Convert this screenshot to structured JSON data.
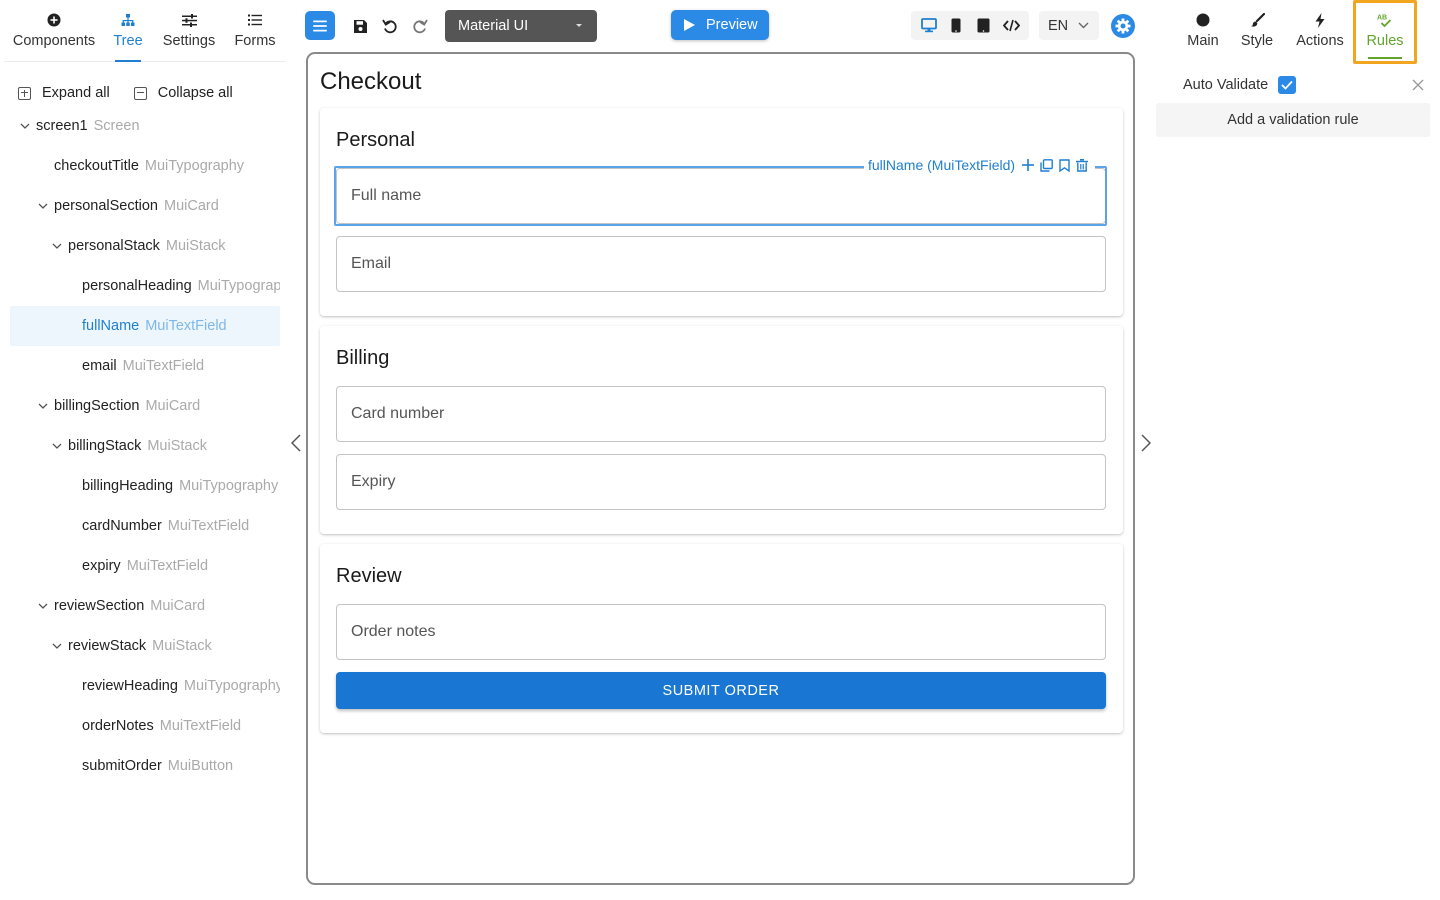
{
  "left_tabs": [
    {
      "label": "Components",
      "icon": "add-circle-icon"
    },
    {
      "label": "Tree",
      "icon": "sitemap-icon",
      "active": true
    },
    {
      "label": "Settings",
      "icon": "sliders-icon"
    },
    {
      "label": "Forms",
      "icon": "list-icon"
    }
  ],
  "tree_actions": {
    "expand_all": "Expand all",
    "collapse_all": "Collapse all"
  },
  "tree": [
    {
      "name": "screen1",
      "type": "Screen",
      "depth": 0,
      "expanded": true
    },
    {
      "name": "checkoutTitle",
      "type": "MuiTypography",
      "depth": 1
    },
    {
      "name": "personalSection",
      "type": "MuiCard",
      "depth": 1,
      "expanded": true
    },
    {
      "name": "personalStack",
      "type": "MuiStack",
      "depth": 2,
      "expanded": true
    },
    {
      "name": "personalHeading",
      "type": "MuiTypography",
      "depth": 3
    },
    {
      "name": "fullName",
      "type": "MuiTextField",
      "depth": 3,
      "selected": true
    },
    {
      "name": "email",
      "type": "MuiTextField",
      "depth": 3
    },
    {
      "name": "billingSection",
      "type": "MuiCard",
      "depth": 1,
      "expanded": true
    },
    {
      "name": "billingStack",
      "type": "MuiStack",
      "depth": 2,
      "expanded": true
    },
    {
      "name": "billingHeading",
      "type": "MuiTypography",
      "depth": 3
    },
    {
      "name": "cardNumber",
      "type": "MuiTextField",
      "depth": 3
    },
    {
      "name": "expiry",
      "type": "MuiTextField",
      "depth": 3
    },
    {
      "name": "reviewSection",
      "type": "MuiCard",
      "depth": 1,
      "expanded": true
    },
    {
      "name": "reviewStack",
      "type": "MuiStack",
      "depth": 2,
      "expanded": true
    },
    {
      "name": "reviewHeading",
      "type": "MuiTypography",
      "depth": 3
    },
    {
      "name": "orderNotes",
      "type": "MuiTextField",
      "depth": 3
    },
    {
      "name": "submitOrder",
      "type": "MuiButton",
      "depth": 3
    }
  ],
  "toolbar": {
    "theme_select": "Material UI",
    "preview_label": "Preview",
    "language": "EN"
  },
  "canvas": {
    "title": "Checkout",
    "personal": {
      "heading": "Personal",
      "full_name_placeholder": "Full name",
      "email_placeholder": "Email"
    },
    "billing": {
      "heading": "Billing",
      "card_number_placeholder": "Card number",
      "expiry_placeholder": "Expiry"
    },
    "review": {
      "heading": "Review",
      "order_notes_placeholder": "Order notes",
      "submit_label": "SUBMIT ORDER"
    },
    "selection_label": "fullName (MuiTextField)"
  },
  "right_tabs": [
    {
      "label": "Main",
      "icon": "circle-icon"
    },
    {
      "label": "Style",
      "icon": "brush-icon"
    },
    {
      "label": "Actions",
      "icon": "bolt-icon"
    },
    {
      "label": "Rules",
      "icon": "spellcheck-icon",
      "active": true
    }
  ],
  "rules": {
    "auto_validate_label": "Auto Validate",
    "auto_validate_checked": true,
    "add_rule_label": "Add a validation rule"
  },
  "colors": {
    "accent": "#1f7fd0",
    "primary_button": "#1976d2",
    "rules_active": "#62a42c",
    "rules_highlight": "#f2a51e"
  }
}
